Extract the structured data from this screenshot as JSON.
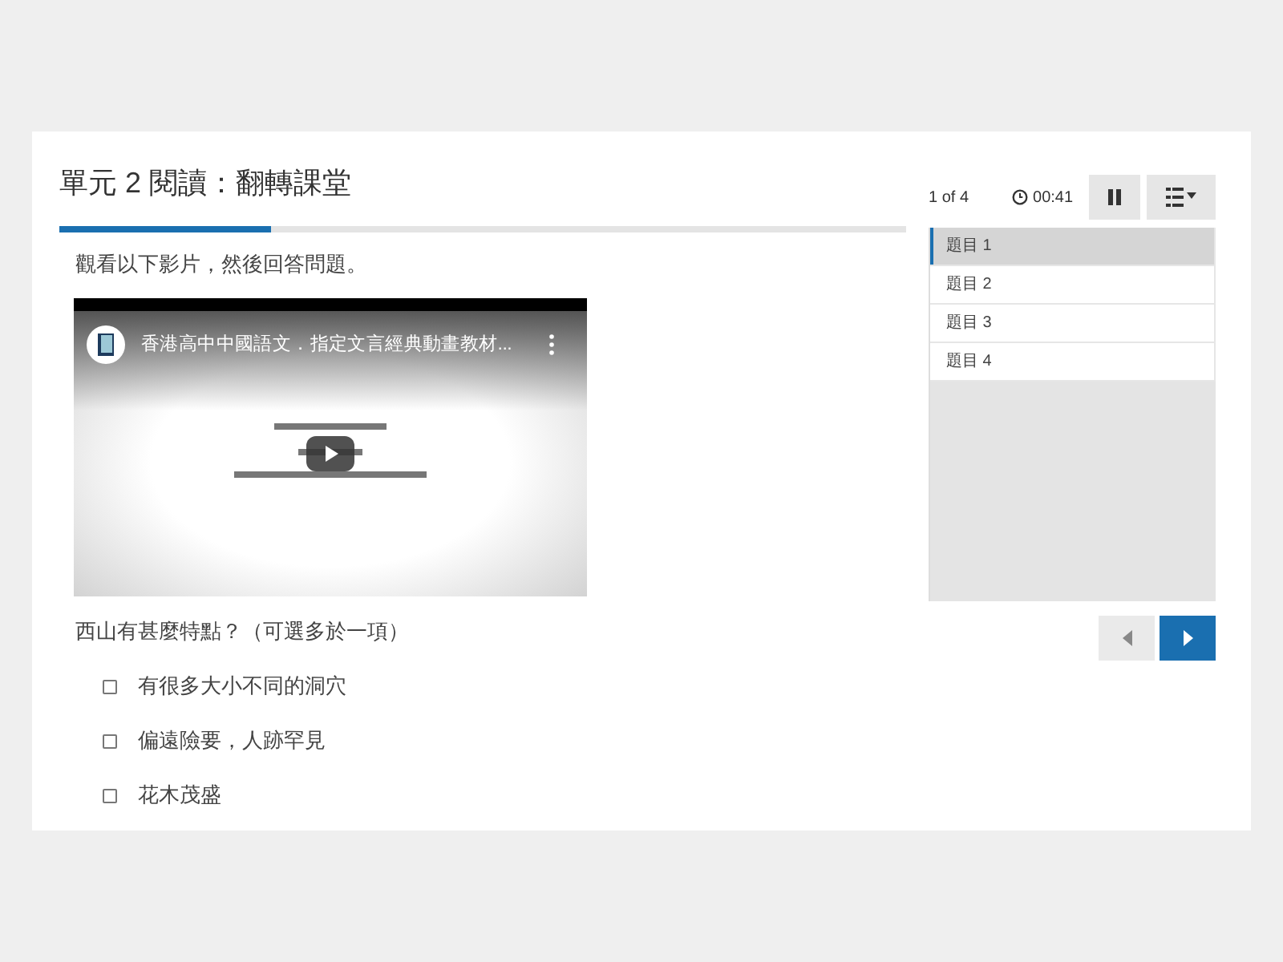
{
  "title": "單元 2 閱讀：翻轉課堂",
  "progress": {
    "level": 0.25
  },
  "instruction": "觀看以下影片，然後回答問題。",
  "video": {
    "title": "香港高中中國語文．指定文言經典動畫教材..."
  },
  "question": "西山有甚麼特點？（可選多於一項）",
  "options": [
    {
      "label": "有很多大小不同的洞穴",
      "checked": false
    },
    {
      "label": "偏遠險要，人跡罕見",
      "checked": false
    },
    {
      "label": "花木茂盛",
      "checked": false
    }
  ],
  "counter": "1 of 4",
  "timer": "00:41",
  "questions": [
    {
      "label": "題目 1",
      "selected": true
    },
    {
      "label": "題目 2",
      "selected": false
    },
    {
      "label": "題目 3",
      "selected": false
    },
    {
      "label": "題目 4",
      "selected": false
    }
  ],
  "nav": {
    "prev_disabled": true
  }
}
